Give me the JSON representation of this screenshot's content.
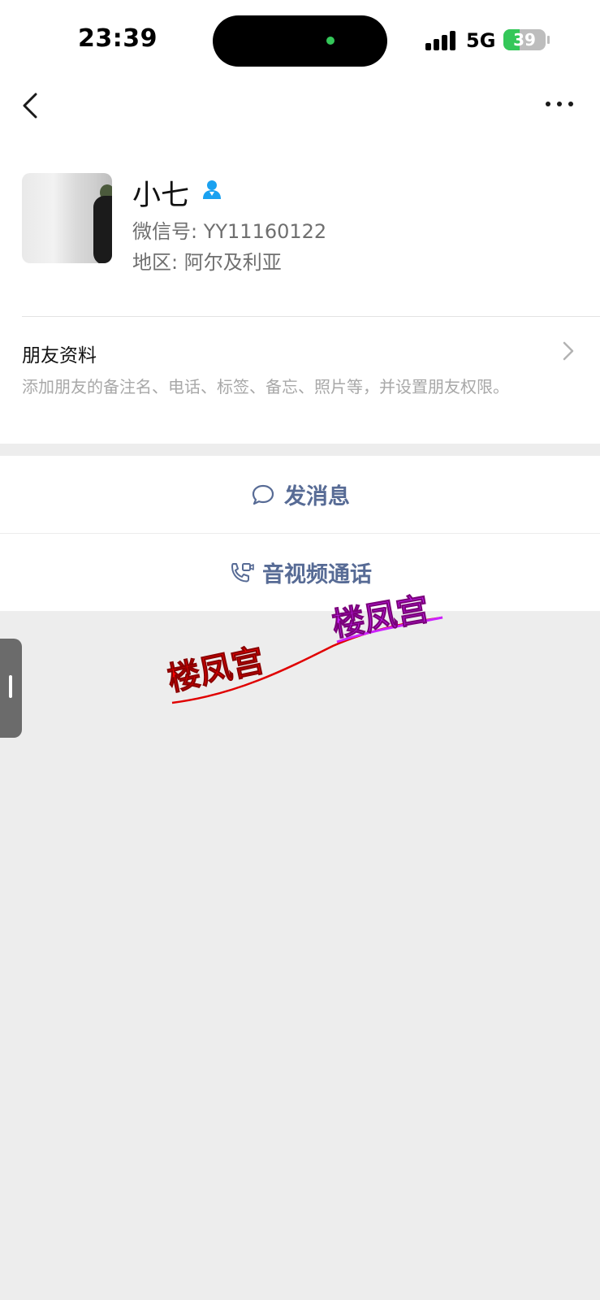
{
  "status_bar": {
    "time": "23:39",
    "network": "5G",
    "battery": "39",
    "battery_level_percent": 39,
    "icons": [
      "signal-icon",
      "battery-charging-icon"
    ]
  },
  "nav": {
    "back_icon": "chevron-left-icon",
    "more_icon": "more-dots-icon"
  },
  "profile": {
    "name": "小七",
    "badge_icon": "contact-person-icon",
    "badge_color": "#1aa1f0",
    "wechat_id": "微信号: YY11160122",
    "region": "地区: 阿尔及利亚"
  },
  "friend_info": {
    "title": "朋友资料",
    "description": "添加朋友的备注名、电话、标签、备忘、照片等，并设置朋友权限。"
  },
  "actions": {
    "send_message": "发消息",
    "av_call": "音视频通话",
    "accent_color": "#576b95"
  },
  "watermark": {
    "text_red": "楼凤宫",
    "text_purple": "楼凤宫",
    "colors": [
      "#ff0000",
      "#cc22ff"
    ]
  }
}
